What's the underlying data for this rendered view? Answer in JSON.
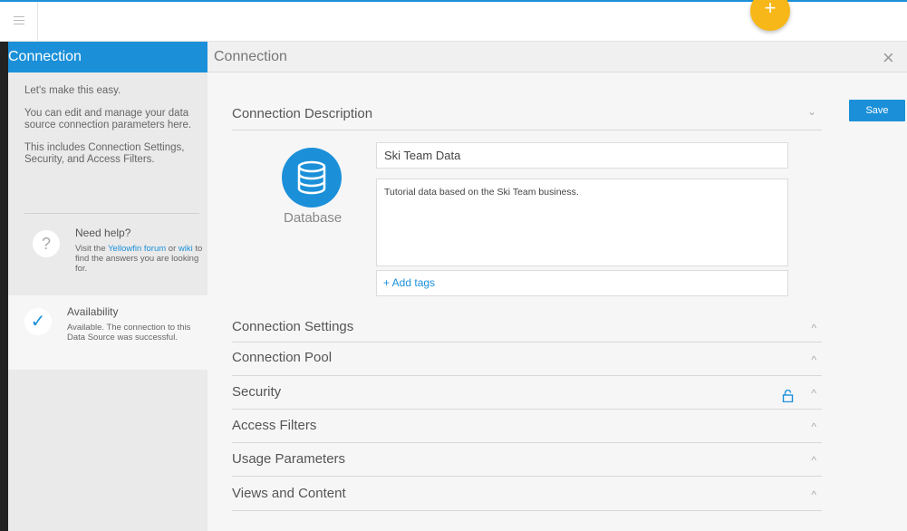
{
  "topbar": {
    "add_label": "+"
  },
  "sidebar": {
    "title": "Connection",
    "intro": "Let's make this easy.",
    "paragraph1": "You can edit and manage your data source connection parameters here.",
    "paragraph2": "This includes Connection Settings, Security, and Access Filters.",
    "help": {
      "title": "Need help?",
      "text_before": "Visit the ",
      "link_forum": "Yellowfin forum",
      "text_mid": " or ",
      "link_wiki": "wiki",
      "text_after": " to find the answers you are looking for.",
      "icon": "?"
    },
    "availability": {
      "title": "Availability",
      "text": "Available. The connection to this Data Source was successful.",
      "icon": "✓"
    }
  },
  "main": {
    "title": "Connection",
    "close": "×",
    "save_label": "Save",
    "sections": {
      "description": "Connection Description",
      "settings": "Connection Settings",
      "pool": "Connection Pool",
      "security": "Security",
      "filters": "Access Filters",
      "usage": "Usage Parameters",
      "views": "Views and Content"
    },
    "chevron_down": "⌄",
    "chevron_up": "^",
    "database_label": "Database",
    "name_value": "Ski Team Data",
    "description_value": "Tutorial data based on the Ski Team business.",
    "add_tags": "+ Add tags"
  },
  "colors": {
    "accent": "#1b90d9",
    "fab": "#f7b718",
    "sidebar_bg": "#eaeaea"
  }
}
